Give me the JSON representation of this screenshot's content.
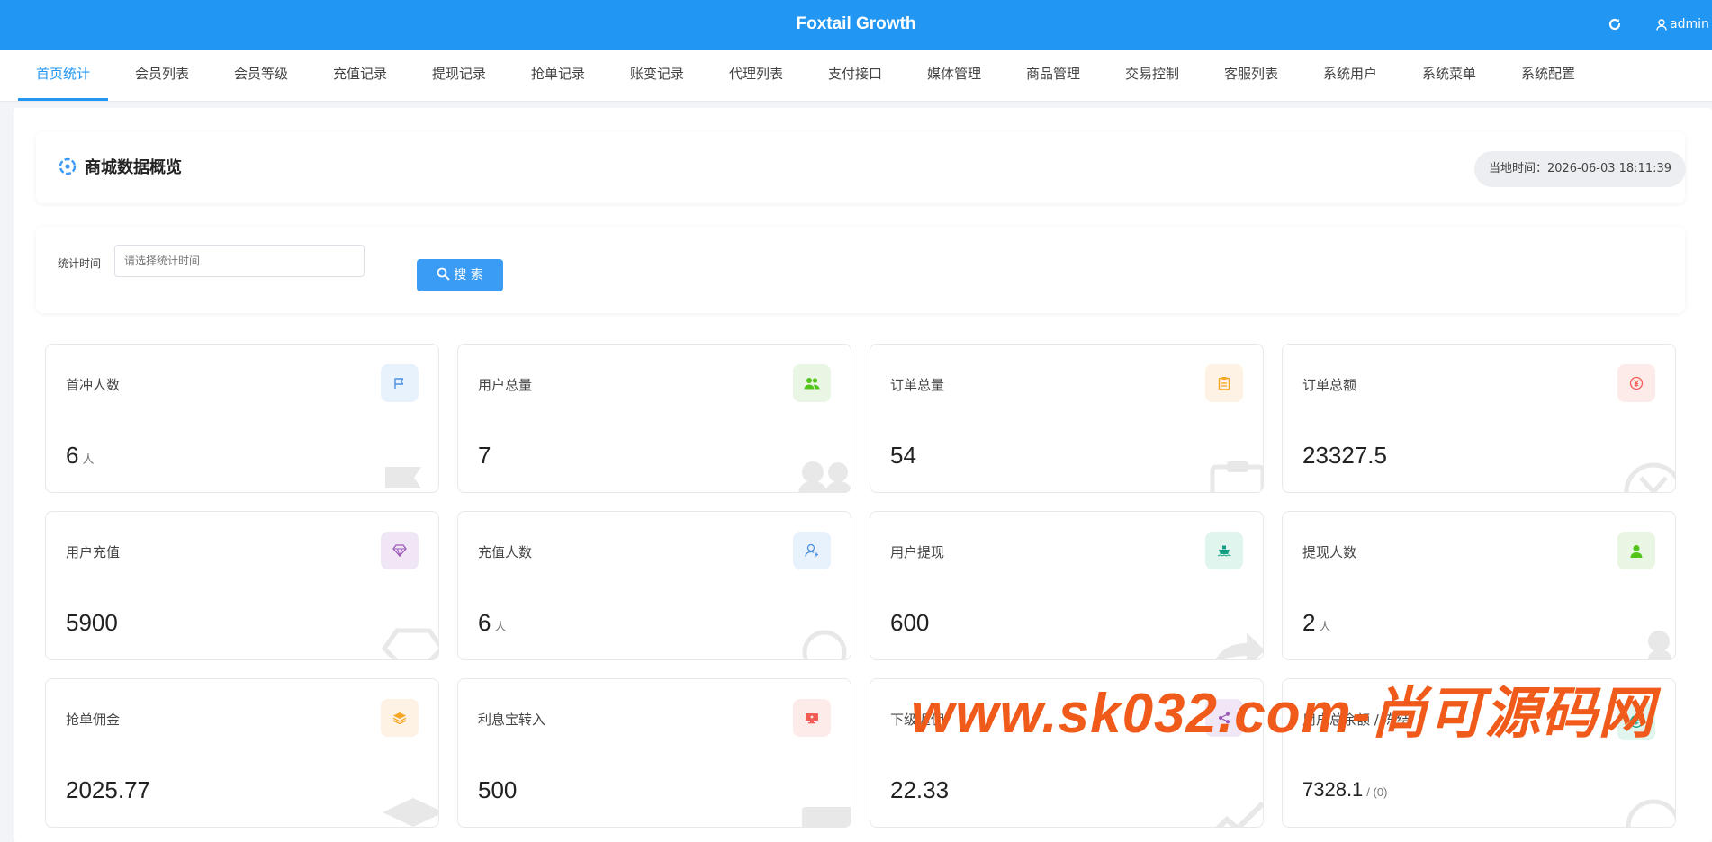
{
  "header": {
    "title": "Foxtail Growth",
    "user": "admin"
  },
  "nav": {
    "items": [
      {
        "label": "首页统计",
        "active": true
      },
      {
        "label": "会员列表"
      },
      {
        "label": "会员等级"
      },
      {
        "label": "充值记录"
      },
      {
        "label": "提现记录"
      },
      {
        "label": "抢单记录"
      },
      {
        "label": "账变记录"
      },
      {
        "label": "代理列表"
      },
      {
        "label": "支付接口"
      },
      {
        "label": "媒体管理"
      },
      {
        "label": "商品管理"
      },
      {
        "label": "交易控制"
      },
      {
        "label": "客服列表"
      },
      {
        "label": "系统用户"
      },
      {
        "label": "系统菜单"
      },
      {
        "label": "系统配置"
      }
    ]
  },
  "overview": {
    "title": "商城数据概览",
    "time_label": "当地时间：",
    "time_value": "2026-06-03 18:11:39"
  },
  "filter": {
    "label": "统计时间",
    "placeholder": "请选择统计时间",
    "search_label": "搜 索"
  },
  "stats": [
    {
      "label": "首冲人数",
      "value": "6",
      "unit": "人",
      "icon": "flag-icon",
      "color": "#4a90e2",
      "bg": "#e8f2fd"
    },
    {
      "label": "用户总量",
      "value": "7",
      "unit": "",
      "icon": "users-icon",
      "color": "#52c41a",
      "bg": "#e9f6e3"
    },
    {
      "label": "订单总量",
      "value": "54",
      "unit": "",
      "icon": "clipboard-icon",
      "color": "#f5a623",
      "bg": "#fdf2e3"
    },
    {
      "label": "订单总额",
      "value": "23327.5",
      "unit": "",
      "icon": "yen-icon",
      "color": "#f25c54",
      "bg": "#fdebea"
    },
    {
      "label": "用户充值",
      "value": "5900",
      "unit": "",
      "icon": "diamond-icon",
      "color": "#9b59b6",
      "bg": "#f1e6f6"
    },
    {
      "label": "充值人数",
      "value": "6",
      "unit": "人",
      "icon": "user-outline-icon",
      "color": "#4a90e2",
      "bg": "#e8f2fd"
    },
    {
      "label": "用户提现",
      "value": "600",
      "unit": "",
      "icon": "ship-icon",
      "color": "#16a085",
      "bg": "#e1f5ef"
    },
    {
      "label": "提现人数",
      "value": "2",
      "unit": "人",
      "icon": "user-icon",
      "color": "#52c41a",
      "bg": "#e9f6e3"
    },
    {
      "label": "抢单佣金",
      "value": "2025.77",
      "unit": "",
      "icon": "layers-icon",
      "color": "#f5a623",
      "bg": "#fdf2e3"
    },
    {
      "label": "利息宝转入",
      "value": "500",
      "unit": "",
      "icon": "display-icon",
      "color": "#f25c54",
      "bg": "#fdebea"
    },
    {
      "label": "下级返佣",
      "value": "22.33",
      "unit": "",
      "icon": "share-icon",
      "color": "#9b59b6",
      "bg": "#f1e6f6"
    },
    {
      "label": "用户总余额 / 冻结",
      "value": "7328.1",
      "unit": "/ (0)",
      "icon": "coin-icon",
      "color": "#16a085",
      "bg": "#e1f5ef"
    }
  ],
  "watermark": "www.sk032.com-尚可源码网"
}
